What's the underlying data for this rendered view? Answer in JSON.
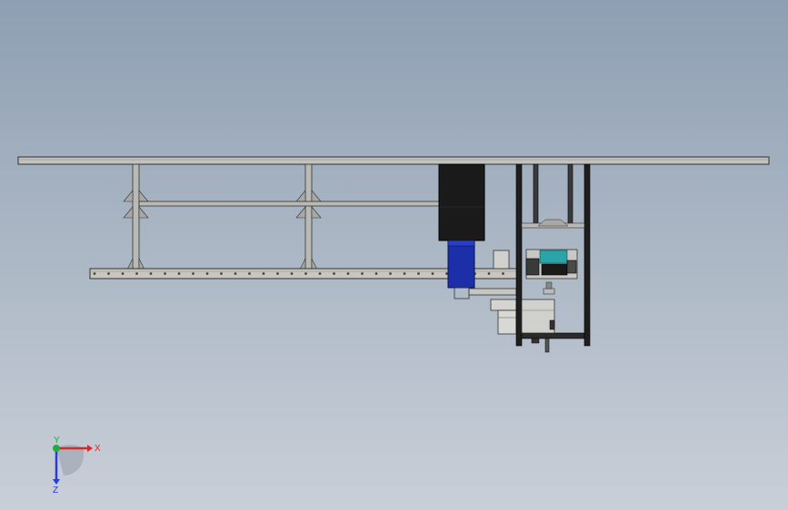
{
  "viewport": {
    "background_top": "#8e9fb3",
    "background_bottom": "#c9cfd8"
  },
  "model": {
    "frame_color": "#b4b4b0",
    "motor_color": "#1a1a1a",
    "actuator_color": "#1c2fa8",
    "module_accent": "#2aa4a8"
  },
  "triad": {
    "x_label": "X",
    "y_label": "Y",
    "z_label": "Z",
    "x_color": "#d42a2a",
    "y_color": "#1fae3a",
    "z_color": "#2a3ad4"
  }
}
